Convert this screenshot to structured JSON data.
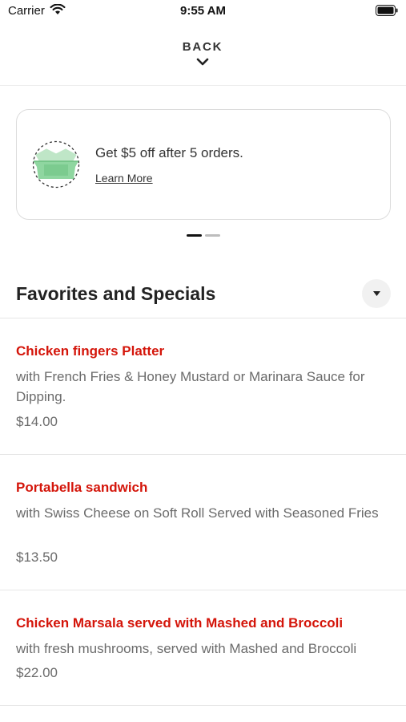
{
  "status_bar": {
    "carrier": "Carrier",
    "time": "9:55 AM"
  },
  "nav": {
    "back_label": "BACK"
  },
  "promo": {
    "text": "Get $5 off after 5 orders.",
    "link": "Learn More",
    "icon": "takeout-box-icon",
    "accent_color": "#8fd6a0"
  },
  "carousel": {
    "total_pages": 2,
    "active_page": 1
  },
  "section": {
    "title": "Favorites and Specials"
  },
  "menu_items": [
    {
      "name": "Chicken fingers Platter",
      "description": "with French Fries & Honey Mustard or Marinara Sauce for Dipping.",
      "price": "$14.00"
    },
    {
      "name": "Portabella sandwich",
      "description": "with Swiss Cheese on Soft Roll Served with Seasoned Fries",
      "price": "$13.50"
    },
    {
      "name": "Chicken Marsala served with Mashed and Broccoli",
      "description": "with fresh mushrooms, served with Mashed and Broccoli",
      "price": "$22.00"
    }
  ],
  "colors": {
    "item_name": "#d4150a",
    "muted_text": "#6b6b6b"
  }
}
